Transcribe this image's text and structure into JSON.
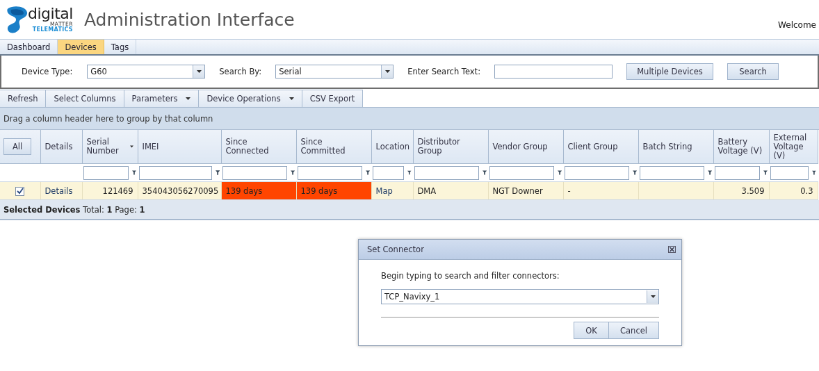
{
  "header": {
    "logo": {
      "word": "digital",
      "line2": "MATTER",
      "line3": "TELEMATICS"
    },
    "title": "Administration Interface",
    "welcome": "Welcome"
  },
  "tabs": [
    {
      "label": "Dashboard",
      "selected": false
    },
    {
      "label": "Devices",
      "selected": true
    },
    {
      "label": "Tags",
      "selected": false
    }
  ],
  "search": {
    "device_type_label": "Device Type:",
    "device_type": "G60",
    "search_by_label": "Search By:",
    "search_by": "Serial",
    "search_text_label": "Enter Search Text:",
    "buttons": [
      "Multiple Devices",
      "Search"
    ]
  },
  "toolbar": [
    {
      "label": "Refresh",
      "menu": false
    },
    {
      "label": "Select Columns",
      "menu": false
    },
    {
      "label": "Parameters",
      "menu": true
    },
    {
      "label": "Device Operations",
      "menu": true
    },
    {
      "label": "CSV Export",
      "menu": false
    }
  ],
  "grid": {
    "group_hint": "Drag a column header here to group by that column",
    "columns": [
      {
        "label": "All",
        "kind": "button",
        "filter": false,
        "sorted": false
      },
      {
        "label": "Details",
        "kind": "text",
        "filter": false,
        "sorted": false
      },
      {
        "label": "Serial Number",
        "kind": "text",
        "filter": true,
        "sorted": true
      },
      {
        "label": "IMEI",
        "kind": "text",
        "filter": true,
        "sorted": false
      },
      {
        "label": "Since Connected",
        "kind": "text",
        "filter": true,
        "sorted": false
      },
      {
        "label": "Since Committed",
        "kind": "text",
        "filter": true,
        "sorted": false
      },
      {
        "label": "Location",
        "kind": "text",
        "filter": true,
        "sorted": false
      },
      {
        "label": "Distributor Group",
        "kind": "text",
        "filter": true,
        "sorted": false
      },
      {
        "label": "Vendor Group",
        "kind": "text",
        "filter": true,
        "sorted": false
      },
      {
        "label": "Client Group",
        "kind": "text",
        "filter": true,
        "sorted": false
      },
      {
        "label": "Batch String",
        "kind": "text",
        "filter": true,
        "sorted": false
      },
      {
        "label": "Battery Voltage (V)",
        "kind": "text",
        "filter": true,
        "sorted": false
      },
      {
        "label": "External Voltage (V)",
        "kind": "text",
        "filter": true,
        "sorted": false
      }
    ],
    "rows": [
      {
        "cells": [
          {
            "kind": "checkbox",
            "checked": true
          },
          {
            "text": "Details",
            "kind": "link"
          },
          {
            "text": "121469"
          },
          {
            "text": "354043056270095"
          },
          {
            "text": "139 days",
            "color": "#ff4500"
          },
          {
            "text": "139 days",
            "color": "#ff4500"
          },
          {
            "text": "Map",
            "kind": "link"
          },
          {
            "text": "DMA"
          },
          {
            "text": "NGT Downer"
          },
          {
            "text": "-"
          },
          {
            "text": ""
          },
          {
            "text": "3.509"
          },
          {
            "text": "0.3"
          }
        ]
      }
    ],
    "footer": {
      "label": "Selected Devices",
      "total_label": "Total:",
      "total": "1",
      "page_label": "Page:",
      "page": "1"
    }
  },
  "dialog": {
    "title": "Set Connector",
    "prompt": "Begin typing to search and filter connectors:",
    "value": "TCP_Navixy_1",
    "buttons": [
      "OK",
      "Cancel"
    ]
  }
}
